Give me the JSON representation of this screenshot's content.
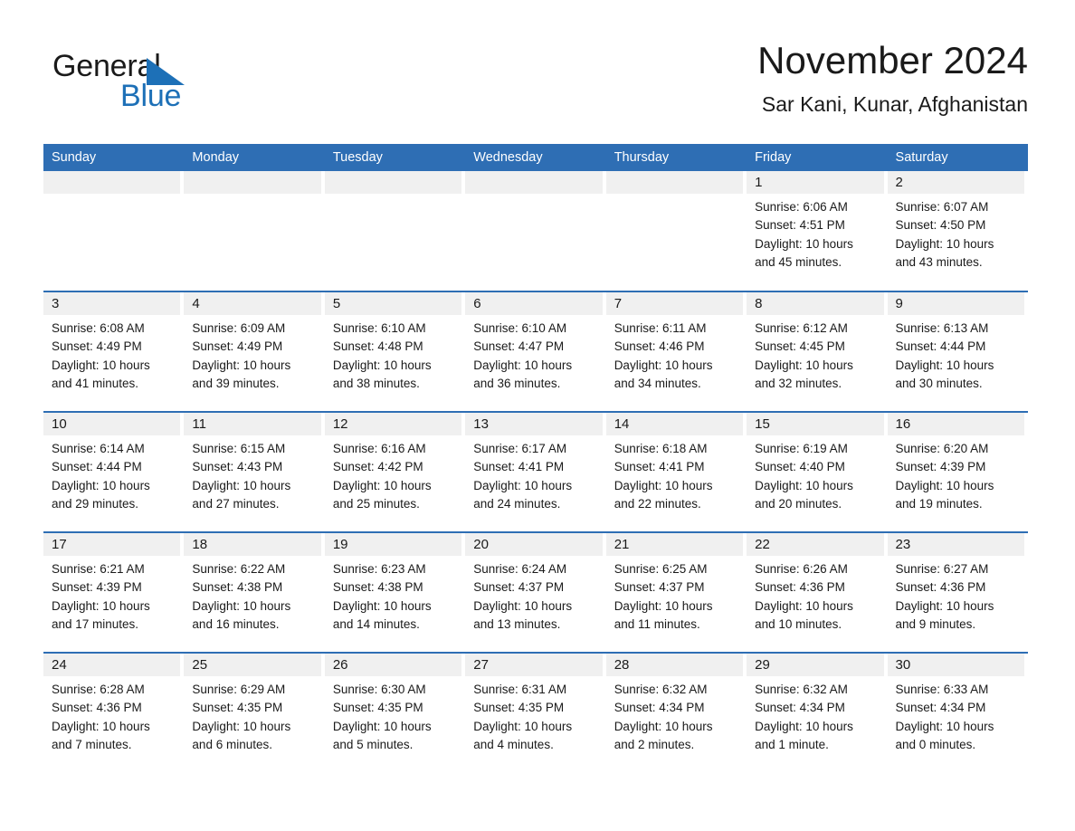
{
  "brand": {
    "name_part1": "General",
    "name_part2": "Blue",
    "triangle_icon": "triangle-icon",
    "accent_color": "#1d70b7"
  },
  "header": {
    "title": "November 2024",
    "location": "Sar Kani, Kunar, Afghanistan"
  },
  "calendar": {
    "header_bg": "#2e6eb4",
    "daycell_bg": "#f0f0f0",
    "weekdays": [
      "Sunday",
      "Monday",
      "Tuesday",
      "Wednesday",
      "Thursday",
      "Friday",
      "Saturday"
    ],
    "weeks": [
      [
        {
          "day": "",
          "empty": true
        },
        {
          "day": "",
          "empty": true
        },
        {
          "day": "",
          "empty": true
        },
        {
          "day": "",
          "empty": true
        },
        {
          "day": "",
          "empty": true
        },
        {
          "day": "1",
          "sunrise": "Sunrise: 6:06 AM",
          "sunset": "Sunset: 4:51 PM",
          "daylight_line1": "Daylight: 10 hours",
          "daylight_line2": "and 45 minutes."
        },
        {
          "day": "2",
          "sunrise": "Sunrise: 6:07 AM",
          "sunset": "Sunset: 4:50 PM",
          "daylight_line1": "Daylight: 10 hours",
          "daylight_line2": "and 43 minutes."
        }
      ],
      [
        {
          "day": "3",
          "sunrise": "Sunrise: 6:08 AM",
          "sunset": "Sunset: 4:49 PM",
          "daylight_line1": "Daylight: 10 hours",
          "daylight_line2": "and 41 minutes."
        },
        {
          "day": "4",
          "sunrise": "Sunrise: 6:09 AM",
          "sunset": "Sunset: 4:49 PM",
          "daylight_line1": "Daylight: 10 hours",
          "daylight_line2": "and 39 minutes."
        },
        {
          "day": "5",
          "sunrise": "Sunrise: 6:10 AM",
          "sunset": "Sunset: 4:48 PM",
          "daylight_line1": "Daylight: 10 hours",
          "daylight_line2": "and 38 minutes."
        },
        {
          "day": "6",
          "sunrise": "Sunrise: 6:10 AM",
          "sunset": "Sunset: 4:47 PM",
          "daylight_line1": "Daylight: 10 hours",
          "daylight_line2": "and 36 minutes."
        },
        {
          "day": "7",
          "sunrise": "Sunrise: 6:11 AM",
          "sunset": "Sunset: 4:46 PM",
          "daylight_line1": "Daylight: 10 hours",
          "daylight_line2": "and 34 minutes."
        },
        {
          "day": "8",
          "sunrise": "Sunrise: 6:12 AM",
          "sunset": "Sunset: 4:45 PM",
          "daylight_line1": "Daylight: 10 hours",
          "daylight_line2": "and 32 minutes."
        },
        {
          "day": "9",
          "sunrise": "Sunrise: 6:13 AM",
          "sunset": "Sunset: 4:44 PM",
          "daylight_line1": "Daylight: 10 hours",
          "daylight_line2": "and 30 minutes."
        }
      ],
      [
        {
          "day": "10",
          "sunrise": "Sunrise: 6:14 AM",
          "sunset": "Sunset: 4:44 PM",
          "daylight_line1": "Daylight: 10 hours",
          "daylight_line2": "and 29 minutes."
        },
        {
          "day": "11",
          "sunrise": "Sunrise: 6:15 AM",
          "sunset": "Sunset: 4:43 PM",
          "daylight_line1": "Daylight: 10 hours",
          "daylight_line2": "and 27 minutes."
        },
        {
          "day": "12",
          "sunrise": "Sunrise: 6:16 AM",
          "sunset": "Sunset: 4:42 PM",
          "daylight_line1": "Daylight: 10 hours",
          "daylight_line2": "and 25 minutes."
        },
        {
          "day": "13",
          "sunrise": "Sunrise: 6:17 AM",
          "sunset": "Sunset: 4:41 PM",
          "daylight_line1": "Daylight: 10 hours",
          "daylight_line2": "and 24 minutes."
        },
        {
          "day": "14",
          "sunrise": "Sunrise: 6:18 AM",
          "sunset": "Sunset: 4:41 PM",
          "daylight_line1": "Daylight: 10 hours",
          "daylight_line2": "and 22 minutes."
        },
        {
          "day": "15",
          "sunrise": "Sunrise: 6:19 AM",
          "sunset": "Sunset: 4:40 PM",
          "daylight_line1": "Daylight: 10 hours",
          "daylight_line2": "and 20 minutes."
        },
        {
          "day": "16",
          "sunrise": "Sunrise: 6:20 AM",
          "sunset": "Sunset: 4:39 PM",
          "daylight_line1": "Daylight: 10 hours",
          "daylight_line2": "and 19 minutes."
        }
      ],
      [
        {
          "day": "17",
          "sunrise": "Sunrise: 6:21 AM",
          "sunset": "Sunset: 4:39 PM",
          "daylight_line1": "Daylight: 10 hours",
          "daylight_line2": "and 17 minutes."
        },
        {
          "day": "18",
          "sunrise": "Sunrise: 6:22 AM",
          "sunset": "Sunset: 4:38 PM",
          "daylight_line1": "Daylight: 10 hours",
          "daylight_line2": "and 16 minutes."
        },
        {
          "day": "19",
          "sunrise": "Sunrise: 6:23 AM",
          "sunset": "Sunset: 4:38 PM",
          "daylight_line1": "Daylight: 10 hours",
          "daylight_line2": "and 14 minutes."
        },
        {
          "day": "20",
          "sunrise": "Sunrise: 6:24 AM",
          "sunset": "Sunset: 4:37 PM",
          "daylight_line1": "Daylight: 10 hours",
          "daylight_line2": "and 13 minutes."
        },
        {
          "day": "21",
          "sunrise": "Sunrise: 6:25 AM",
          "sunset": "Sunset: 4:37 PM",
          "daylight_line1": "Daylight: 10 hours",
          "daylight_line2": "and 11 minutes."
        },
        {
          "day": "22",
          "sunrise": "Sunrise: 6:26 AM",
          "sunset": "Sunset: 4:36 PM",
          "daylight_line1": "Daylight: 10 hours",
          "daylight_line2": "and 10 minutes."
        },
        {
          "day": "23",
          "sunrise": "Sunrise: 6:27 AM",
          "sunset": "Sunset: 4:36 PM",
          "daylight_line1": "Daylight: 10 hours",
          "daylight_line2": "and 9 minutes."
        }
      ],
      [
        {
          "day": "24",
          "sunrise": "Sunrise: 6:28 AM",
          "sunset": "Sunset: 4:36 PM",
          "daylight_line1": "Daylight: 10 hours",
          "daylight_line2": "and 7 minutes."
        },
        {
          "day": "25",
          "sunrise": "Sunrise: 6:29 AM",
          "sunset": "Sunset: 4:35 PM",
          "daylight_line1": "Daylight: 10 hours",
          "daylight_line2": "and 6 minutes."
        },
        {
          "day": "26",
          "sunrise": "Sunrise: 6:30 AM",
          "sunset": "Sunset: 4:35 PM",
          "daylight_line1": "Daylight: 10 hours",
          "daylight_line2": "and 5 minutes."
        },
        {
          "day": "27",
          "sunrise": "Sunrise: 6:31 AM",
          "sunset": "Sunset: 4:35 PM",
          "daylight_line1": "Daylight: 10 hours",
          "daylight_line2": "and 4 minutes."
        },
        {
          "day": "28",
          "sunrise": "Sunrise: 6:32 AM",
          "sunset": "Sunset: 4:34 PM",
          "daylight_line1": "Daylight: 10 hours",
          "daylight_line2": "and 2 minutes."
        },
        {
          "day": "29",
          "sunrise": "Sunrise: 6:32 AM",
          "sunset": "Sunset: 4:34 PM",
          "daylight_line1": "Daylight: 10 hours",
          "daylight_line2": "and 1 minute."
        },
        {
          "day": "30",
          "sunrise": "Sunrise: 6:33 AM",
          "sunset": "Sunset: 4:34 PM",
          "daylight_line1": "Daylight: 10 hours",
          "daylight_line2": "and 0 minutes."
        }
      ]
    ]
  }
}
